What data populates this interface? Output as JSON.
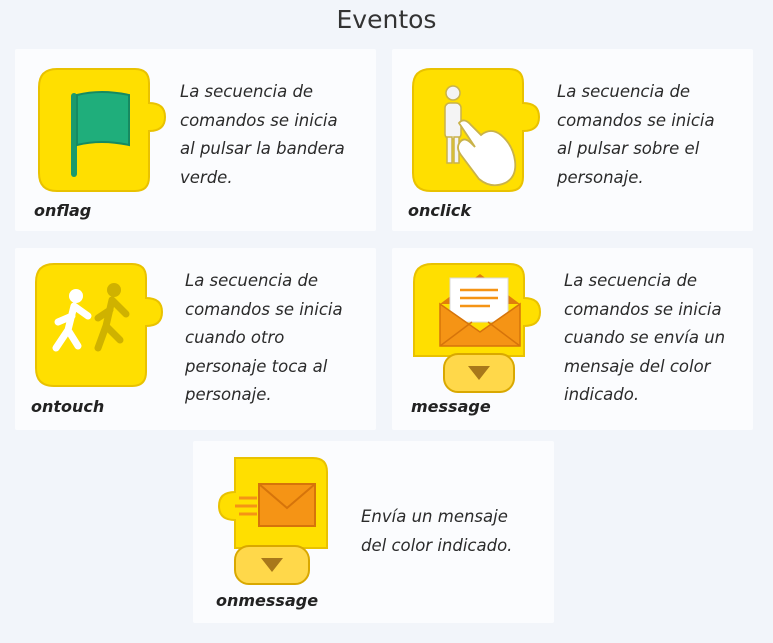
{
  "title": "Eventos",
  "colors": {
    "block_yellow": "#ffdf00",
    "block_edge": "#e9c200",
    "flag_green": "#1fae7b",
    "envelope_orange": "#f59415",
    "card_bg": "#fbfcfe"
  },
  "cards": [
    {
      "name": "onflag",
      "icon": "green-flag-icon",
      "desc": [
        "La secuencia de",
        "comandos se inicia",
        "al pulsar la bandera",
        "verde."
      ]
    },
    {
      "name": "onclick",
      "icon": "touch-hand-icon",
      "desc": [
        "La secuencia de",
        "comandos se inicia",
        "al pulsar sobre el",
        "personaje."
      ]
    },
    {
      "name": "ontouch",
      "icon": "running-figures-icon",
      "desc": [
        "La secuencia de",
        "comandos se inicia",
        "cuando otro",
        "personaje toca al",
        "personaje."
      ]
    },
    {
      "name": "message",
      "icon": "open-envelope-icon",
      "desc": [
        "La secuencia de",
        "comandos se inicia",
        "cuando se envía un",
        "mensaje del color",
        "indicado."
      ]
    },
    {
      "name": "onmessage",
      "icon": "flying-envelope-icon",
      "desc": [
        "Envía un mensaje",
        "del color indicado."
      ]
    }
  ]
}
